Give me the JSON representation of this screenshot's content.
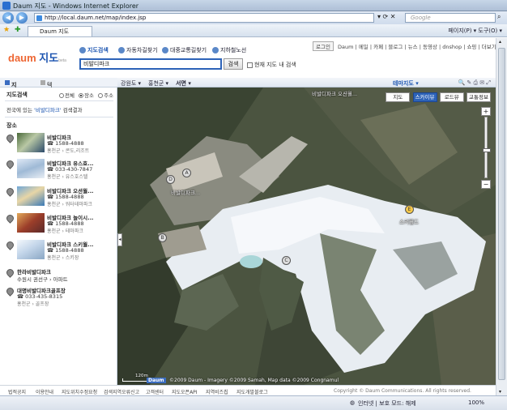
{
  "window": {
    "title": "Daum 지도 - Windows Internet Explorer"
  },
  "browser": {
    "url": "http://local.daum.net/map/index.jsp",
    "search_placeholder": "Google",
    "tab_label": "Daum 지도",
    "tools": "페이지(P) ▾  도구(O) ▾"
  },
  "site": {
    "logo_daum": "daum",
    "logo_map": "지도",
    "logo_beta": "beta",
    "services": [
      "지도검색",
      "자동차길찾기",
      "대중교통길찾기",
      "지하철노선"
    ],
    "query": "비발디파크",
    "search_button": "검색",
    "within_map_label": "현재 지도 내 검색",
    "top_links": [
      "로그인",
      "Daum",
      "메일",
      "카페",
      "블로그",
      "뉴스",
      "동영상",
      "dnshop",
      "쇼핑",
      "더보기 ▾"
    ]
  },
  "left": {
    "tab_map": "지도보기",
    "tab_text": "텍스트보기",
    "scope_label": "지도검색",
    "scopes": [
      "전체",
      "장소",
      "주소"
    ],
    "summary_prefix": "전국에 있는",
    "summary_query": "'비발디파크'",
    "summary_suffix": "검색결과",
    "section": "장소",
    "results": [
      {
        "name": "비발디파크",
        "phone": "☎ 1588-4888",
        "category": "홍천군 › 콘도,리조트"
      },
      {
        "name": "비발디파크 유스호...",
        "phone": "☎ 033-430-7847",
        "category": "홍천군 › 유스호스텔"
      },
      {
        "name": "비발디파크 오션월...",
        "phone": "☎ 1588-4888",
        "category": "홍천군 › 워터테마파크"
      },
      {
        "name": "비발디파크 놀이시...",
        "phone": "☎ 1588-4888",
        "category": "홍천군 › 테마파크"
      },
      {
        "name": "비발디파크 스키월...",
        "phone": "☎ 1588-4888",
        "category": "홍천군 › 스키장"
      }
    ],
    "extra": [
      {
        "name": "한라비발디파크",
        "phone": "",
        "category": "수원시 권선구 › 아파트"
      },
      {
        "name": "대명비발디파크골프장",
        "phone": "☎ 033-435-8315",
        "category": "홍천군 › 골프장"
      }
    ]
  },
  "maptool": {
    "crumbs": [
      "강원도 ▾",
      "홍천군 ▾",
      "서면 ▾"
    ],
    "theme": "테마지도 ▾",
    "icons": "🔍 ✎ ⎙ ✉ ⤢"
  },
  "map": {
    "buttons": [
      "지도",
      "스카이뷰",
      "로드뷰",
      "교통정보"
    ],
    "active": "스카이뷰",
    "markers": [
      "A",
      "B",
      "C",
      "D",
      "E"
    ],
    "labels": {
      "a": "비발디파크...",
      "b": "스키월드",
      "top": "비발디파크 오션월..."
    },
    "copyright": "©2009 Daum - Imagery ©2009 Samah, Map data ©2009 Congnamul",
    "scale": "120m",
    "map_logo": "Daum"
  },
  "footer": [
    "법적공지",
    "이용안내",
    "지도위치수정요청",
    "검색지역오류신고",
    "고객센터",
    "지도오픈API",
    "지역비즈칩",
    "지도개발블로그",
    "Copyright © Daum Communications. All rights reserved."
  ],
  "status": {
    "zone": "인터넷 | 보호 모드: 해제",
    "zoom": "100%"
  }
}
